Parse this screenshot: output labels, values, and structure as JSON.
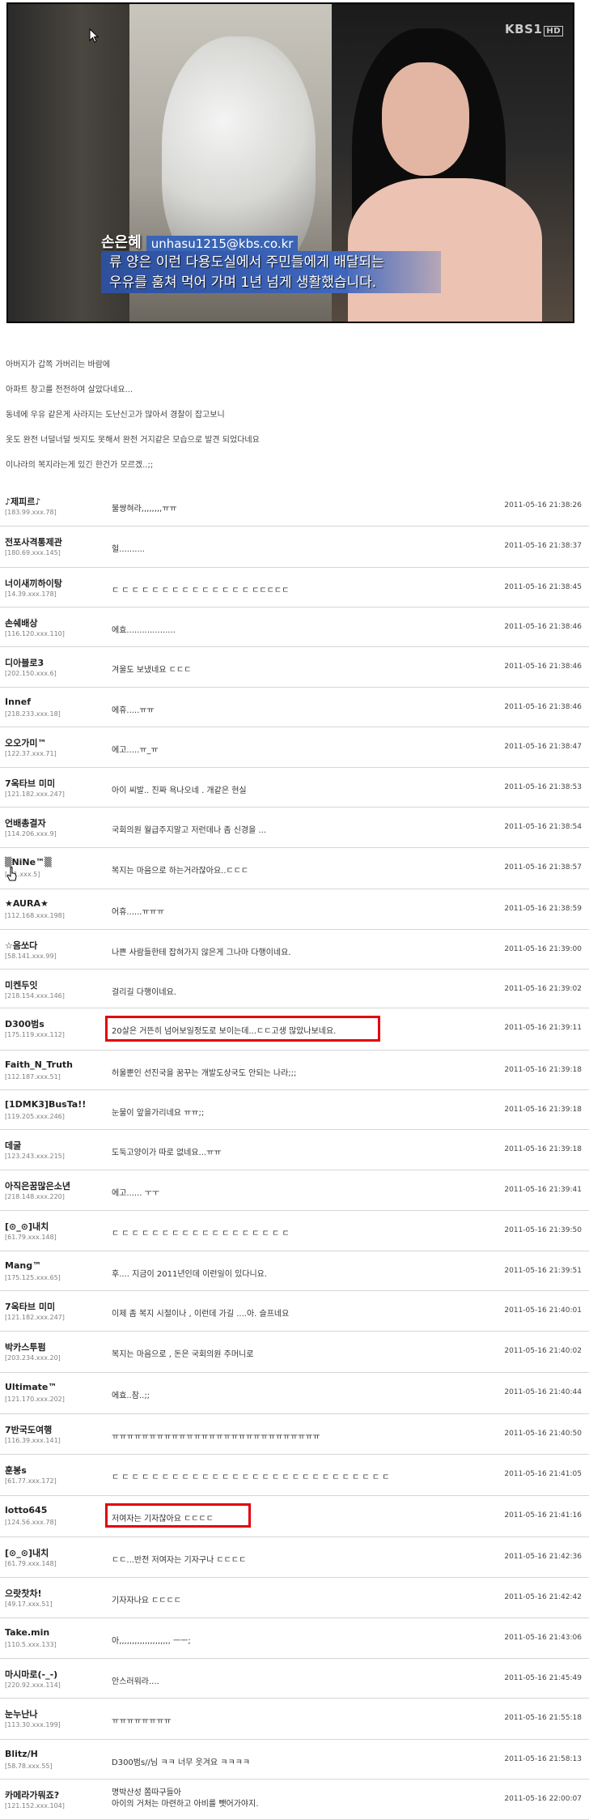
{
  "broadcast": {
    "logo": "KBS1",
    "logo_badge": "HD",
    "reporter": "손은혜",
    "email": "unhasu1215@kbs.co.kr",
    "caption_lines": [
      "류 양은 이런 다용도실에서 주민들에게 배달되는",
      "우유를 훔쳐 먹어 가며 1년 넘게 생활했습니다."
    ]
  },
  "story_lines": [
    "아버지가 갑쪽 가버리는 바람에",
    "아파트 창고를 전전하여 살았다네요...",
    "동네에 우유 같은게 사라지는 도난신고가 많아서 경찰이 잡고보니",
    "옷도 완전 너덜너덜 씻지도 못해서 완전 거지같은 모습으로 발견 되었다네요",
    "이나라의 복지라는게 있긴 한건가 모르겠..;;"
  ],
  "comments": [
    {
      "nick": "♪제피르♪",
      "ip": "[183.99.xxx.78]",
      "msg": "불쌍혀라,,,,,,,,ㅠㅠ",
      "time": "2011-05-16 21:38:26"
    },
    {
      "nick": "전포사격통제관",
      "ip": "[180.69.xxx.145]",
      "msg": "헐..........",
      "time": "2011-05-16 21:38:37"
    },
    {
      "nick": "너이새끼하이탕",
      "ip": "[14.39.xxx.178]",
      "msg": "ㄷ ㄷ ㄷ ㄷ ㄷ ㄷ ㄷ ㄷ ㄷ ㄷ ㄷ ㄷ ㄷ ㄷ ㄷㄷㄷㄷㄷ",
      "time": "2011-05-16 21:38:45"
    },
    {
      "nick": "손쉐배상",
      "ip": "[116.120.xxx.110]",
      "msg": "에효...................",
      "time": "2011-05-16 21:38:46"
    },
    {
      "nick": "디아블로3",
      "ip": "[202.150.xxx.6]",
      "msg": "겨울도 보냈네요 ㄷㄷㄷ",
      "time": "2011-05-16 21:38:46"
    },
    {
      "nick": "Innef",
      "ip": "[218.233.xxx.18]",
      "msg": "에휴.....ㅠㅠ",
      "time": "2011-05-16 21:38:46"
    },
    {
      "nick": "오오가미™",
      "ip": "[122.37.xxx.71]",
      "msg": "에고.....ㅠ_ㅠ",
      "time": "2011-05-16 21:38:47"
    },
    {
      "nick": "7옥타브 미미",
      "ip": "[121.182.xxx.247]",
      "msg": "아이 씨발.. 진짜 욕나오네 . 개같은 현실",
      "time": "2011-05-16 21:38:53"
    },
    {
      "nick": "언배총결자",
      "ip": "[114.206.xxx.9]",
      "msg": "국회의원 월급주지말고 저런데나 좀 신경을 ...",
      "time": "2011-05-16 21:38:54"
    },
    {
      "nick": "▒NiNe™▒",
      "ip": "[ 21.xxx.5]",
      "msg": "복지는 마음으로 하는거라잖아요..ㄷㄷㄷ",
      "time": "2011-05-16 21:38:57"
    },
    {
      "nick": "★AURA★",
      "ip": "[112.168.xxx.198]",
      "msg": "어휴......ㅠㅠㅠ",
      "time": "2011-05-16 21:38:59"
    },
    {
      "nick": "☆음쏘다",
      "ip": "[58.141.xxx.99]",
      "msg": "나쁜 사람들한테 잡혀가지 않은게 그나마 다행이네요.",
      "time": "2011-05-16 21:39:00"
    },
    {
      "nick": "미켄두잇",
      "ip": "[218.154.xxx.146]",
      "msg": "걸리길 다행이네요.",
      "time": "2011-05-16 21:39:02"
    },
    {
      "nick": "D300범s",
      "ip": "[175.119.xxx.112]",
      "msg": "20살은 거뜬히 넘어보일정도로 보이는데...ㄷㄷ고생 많았나보네요.",
      "time": "2011-05-16 21:39:11"
    },
    {
      "nick": "Faith_N_Truth",
      "ip": "[112.187.xxx.51]",
      "msg": "허울뿐인 선진국을 꿈꾸는 개발도상국도 안되는 나라;;;",
      "time": "2011-05-16 21:39:18"
    },
    {
      "nick": "[1DMK3]BusTa!!",
      "ip": "[119.205.xxx.246]",
      "msg": "눈물이 앞을가리네요 ㅠㅠ;;",
      "time": "2011-05-16 21:39:18"
    },
    {
      "nick": "데굴",
      "ip": "[123.243.xxx.215]",
      "msg": "도둑고양이가 따로 없네요...ㅠㅠ",
      "time": "2011-05-16 21:39:18"
    },
    {
      "nick": "아직은꿈많은소년",
      "ip": "[218.148.xxx.220]",
      "msg": "에고...... ㅜㅜ",
      "time": "2011-05-16 21:39:41"
    },
    {
      "nick": "[⊙_⊙]내치",
      "ip": "[61.79.xxx.148]",
      "msg": "ㄷ ㄷ ㄷ ㄷ ㄷ ㄷ ㄷ ㄷ ㄷ ㄷ ㄷ ㄷ ㄷ ㄷ ㄷ ㄷ ㄷ ㄷ",
      "time": "2011-05-16 21:39:50"
    },
    {
      "nick": "Mang™",
      "ip": "[175.125.xxx.65]",
      "msg": "후.... 지금이 2011년인데 이런일이 있다니요.",
      "time": "2011-05-16 21:39:51"
    },
    {
      "nick": "7옥타브 미미",
      "ip": "[121.182.xxx.247]",
      "msg": "이제 좀 복지 시절이나 , 이런데 가길 ....아. 슬프네요",
      "time": "2011-05-16 21:40:01"
    },
    {
      "nick": "박카스투펌",
      "ip": "[203.234.xxx.20]",
      "msg": "복지는 마음으로 , 돈은 국회의원 주머니로",
      "time": "2011-05-16 21:40:02"
    },
    {
      "nick": "Ultimate™",
      "ip": "[121.170.xxx.202]",
      "msg": "에효..참..;;",
      "time": "2011-05-16 21:40:44"
    },
    {
      "nick": "7반국도여행",
      "ip": "[116.39.xxx.141]",
      "msg": "ㅠㅠㅠㅠㅠㅠㅠㅠㅠㅠㅠㅠㅠㅠㅠㅠㅠㅠㅠㅠㅠㅠㅠㅠㅠㅠㅠㅠ",
      "time": "2011-05-16 21:40:50"
    },
    {
      "nick": "훈봉s",
      "ip": "[61.77.xxx.172]",
      "msg": "ㄷ ㄷ ㄷ ㄷ ㄷ ㄷ ㄷ ㄷ ㄷ ㄷ ㄷ ㄷ ㄷ ㄷ ㄷ ㄷ ㄷ ㄷ ㄷ ㄷ ㄷ ㄷ ㄷ ㄷ ㄷ ㄷ ㄷ ㄷ",
      "time": "2011-05-16 21:41:05"
    },
    {
      "nick": "lotto645",
      "ip": "[124.56.xxx.78]",
      "msg": "저여자는 기자잖아요 ㄷㄷㄷㄷ",
      "time": "2011-05-16 21:41:16"
    },
    {
      "nick": "[⊙_⊙]내치",
      "ip": "[61.79.xxx.148]",
      "msg": "ㄷㄷ...반전 저여자는 기자구나 ㄷㄷㄷㄷ",
      "time": "2011-05-16 21:42:36"
    },
    {
      "nick": "으랏찻차!",
      "ip": "[49.17.xxx.51]",
      "msg": "기자자나요 ㄷㄷㄷㄷ",
      "time": "2011-05-16 21:42:42"
    },
    {
      "nick": "Take.min",
      "ip": "[110.5.xxx.133]",
      "msg": "아,,,,,,,,,,,,,,,,,,,, ㅡㅡ;",
      "time": "2011-05-16 21:43:06"
    },
    {
      "nick": "마시마로(-_-)",
      "ip": "[220.92.xxx.114]",
      "msg": "안스러워라....",
      "time": "2011-05-16 21:45:49"
    },
    {
      "nick": "눈누난나",
      "ip": "[113.30.xxx.199]",
      "msg": "ㅠㅠㅠㅠㅠㅠㅠㅠ",
      "time": "2011-05-16 21:55:18"
    },
    {
      "nick": "Blitz/H",
      "ip": "[58.78.xxx.55]",
      "msg": "D300범s//님 ㅋㅋ 너무 웃겨요 ㅋㅋㅋㅋ",
      "time": "2011-05-16 21:58:13"
    },
    {
      "nick": "카메라가뭐죠?",
      "ip": "[121.152.xxx.104]",
      "msg": "명박산성 쫌따구들아\n아이의 거처는 마련하고 아비를 뺏어가야지.",
      "time": "2011-05-16 22:00:07"
    }
  ],
  "highlight_color": "#e3000f"
}
